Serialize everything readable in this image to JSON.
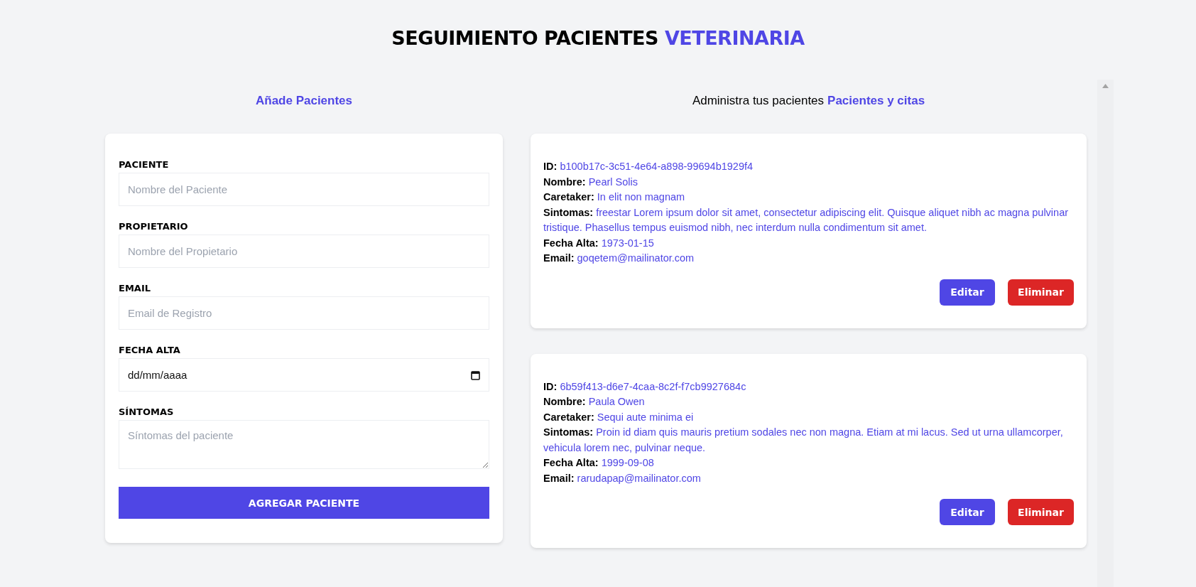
{
  "header": {
    "title": "SEGUIMIENTO PACIENTES",
    "highlight": "VETERINARIA"
  },
  "form": {
    "heading": "Añade Pacientes",
    "fields": [
      {
        "kind": "text",
        "label": "PACIENTE",
        "placeholder": "Nombre del Paciente"
      },
      {
        "kind": "text",
        "label": "PROPIETARIO",
        "placeholder": "Nombre del Propietario"
      },
      {
        "kind": "text",
        "label": "EMAIL",
        "placeholder": "Email de Registro"
      },
      {
        "kind": "date",
        "label": "FECHA ALTA",
        "value": "dd/mm/aaaa"
      },
      {
        "kind": "textarea",
        "label": "SÍNTOMAS",
        "placeholder": "Síntomas del paciente"
      }
    ],
    "submit": "AGREGAR PACIENTE"
  },
  "list": {
    "heading": "Administra tus pacientes",
    "highlight": "Pacientes y citas",
    "patients": [
      {
        "details": [
          {
            "label": "ID:",
            "value": "b100b17c-3c51-4e64-a898-99694b1929f4"
          },
          {
            "label": "Nombre:",
            "value": "Pearl Solis"
          },
          {
            "label": "Caretaker:",
            "value": "In elit non magnam"
          },
          {
            "label": "Sintomas:",
            "value": "freestar Lorem ipsum dolor sit amet, consectetur adipiscing elit. Quisque aliquet nibh ac magna pulvinar tristique. Phasellus tempus euismod nibh, nec interdum nulla condimentum sit amet."
          },
          {
            "label": "Fecha Alta:",
            "value": "1973-01-15"
          },
          {
            "label": "Email:",
            "value": "goqetem@mailinator.com"
          }
        ],
        "actions": [
          "Editar",
          "Eliminar"
        ]
      },
      {
        "details": [
          {
            "label": "ID:",
            "value": "6b59f413-d6e7-4caa-8c2f-f7cb9927684c"
          },
          {
            "label": "Nombre:",
            "value": "Paula Owen"
          },
          {
            "label": "Caretaker:",
            "value": "Sequi aute minima ei"
          },
          {
            "label": "Sintomas:",
            "value": "Proin id diam quis mauris pretium sodales nec non magna. Etiam at mi lacus. Sed ut urna ullamcorper, vehicula lorem nec, pulvinar neque."
          },
          {
            "label": "Fecha Alta:",
            "value": "1999-09-08"
          },
          {
            "label": "Email:",
            "value": "rarudapap@mailinator.com"
          }
        ],
        "actions": [
          "Editar",
          "Eliminar"
        ]
      }
    ]
  }
}
